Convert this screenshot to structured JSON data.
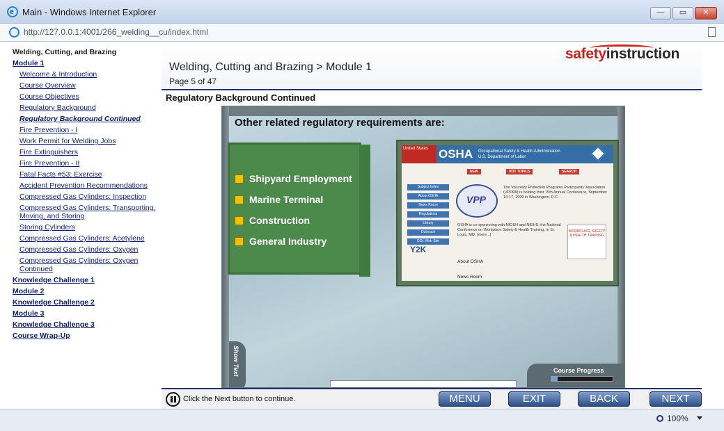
{
  "window": {
    "title": "Main - Windows Internet Explorer",
    "address": "http://127.0.0.1:4001/266_welding__cu/index.html",
    "min_glyph": "—",
    "max_glyph": "▭",
    "close_glyph": "✕"
  },
  "toc": {
    "heading": "Welding, Cutting, and Brazing",
    "module1": "Module 1",
    "module1_items": [
      "Welcome & Introduction",
      "Course Overview",
      "Course Objectives",
      "Regulatory Background",
      "Regulatory Background Continued",
      "Fire Prevention - I",
      "Work Permit for Welding Jobs",
      "Fire Extinguishers",
      "Fire Prevention - II",
      "Fatal Facts #53: Exercise",
      "Accident Prevention Recommendations",
      "Compressed Gas Cylinders: Inspection",
      "Compressed Gas Cylinders: Transporting, Moving, and Storing",
      "Storing Cylinders",
      "Compressed Gas Cylinders: Acetylene",
      "Compressed Gas Cylinders: Oxygen",
      "Compressed Gas Cylinders: Oxygen Continued"
    ],
    "after_items": [
      "Knowledge Challenge 1",
      "Module 2",
      "Knowledge Challenge 2",
      "Module 3",
      "Knowledge Challenge 3",
      "Course Wrap-Up"
    ]
  },
  "header": {
    "module_title": "Welding, Cutting and Brazing > Module 1",
    "page": "Page 5 of 47",
    "logo_a": "safety",
    "logo_b": "instruction"
  },
  "section_title": "Regulatory Background Continued",
  "slide": {
    "heading": "Other related regulatory requirements are:",
    "items": [
      "Shipyard Employment",
      "Marine Terminal",
      "Construction",
      "General Industry"
    ],
    "show_text": "Show Text",
    "progress_label": "Course Progress",
    "progress_fraction": 0.106,
    "osha": {
      "us": "United States",
      "name": "OSHA",
      "sub1": "Occupational Safety & Health Administration",
      "sub2": "U.S. Department of Labor",
      "nav": [
        "NEW",
        "HOT TOPICS",
        "SEARCH"
      ],
      "left": [
        "Subject Index",
        "About OSHA",
        "News Room",
        "Regulations",
        "Library",
        "Outreach",
        "DOL Web Site"
      ],
      "y2k": "Y2K",
      "vpp_text": "The Voluntary Protection Programs Participants' Association (VPPPA) is holding their 15th Annual Conference, September 14-17, 1999 in Washington, D.C.",
      "niehs_text": "OSHA is co-sponsoring with NIOSH and NIEHS, the National Conference on Workplace Safety & Health Training, in St. Louis, MO. [more...]",
      "badge": "WORKPLACE SAFETY & HEALTH TRAINING",
      "about": "About OSHA",
      "news": "News Room"
    }
  },
  "footer": {
    "instruction": "Click the Next button to continue.",
    "menu": "MENU",
    "exit": "EXIT",
    "back": "BACK",
    "next": "NEXT"
  },
  "status": {
    "zoom": "100%"
  }
}
